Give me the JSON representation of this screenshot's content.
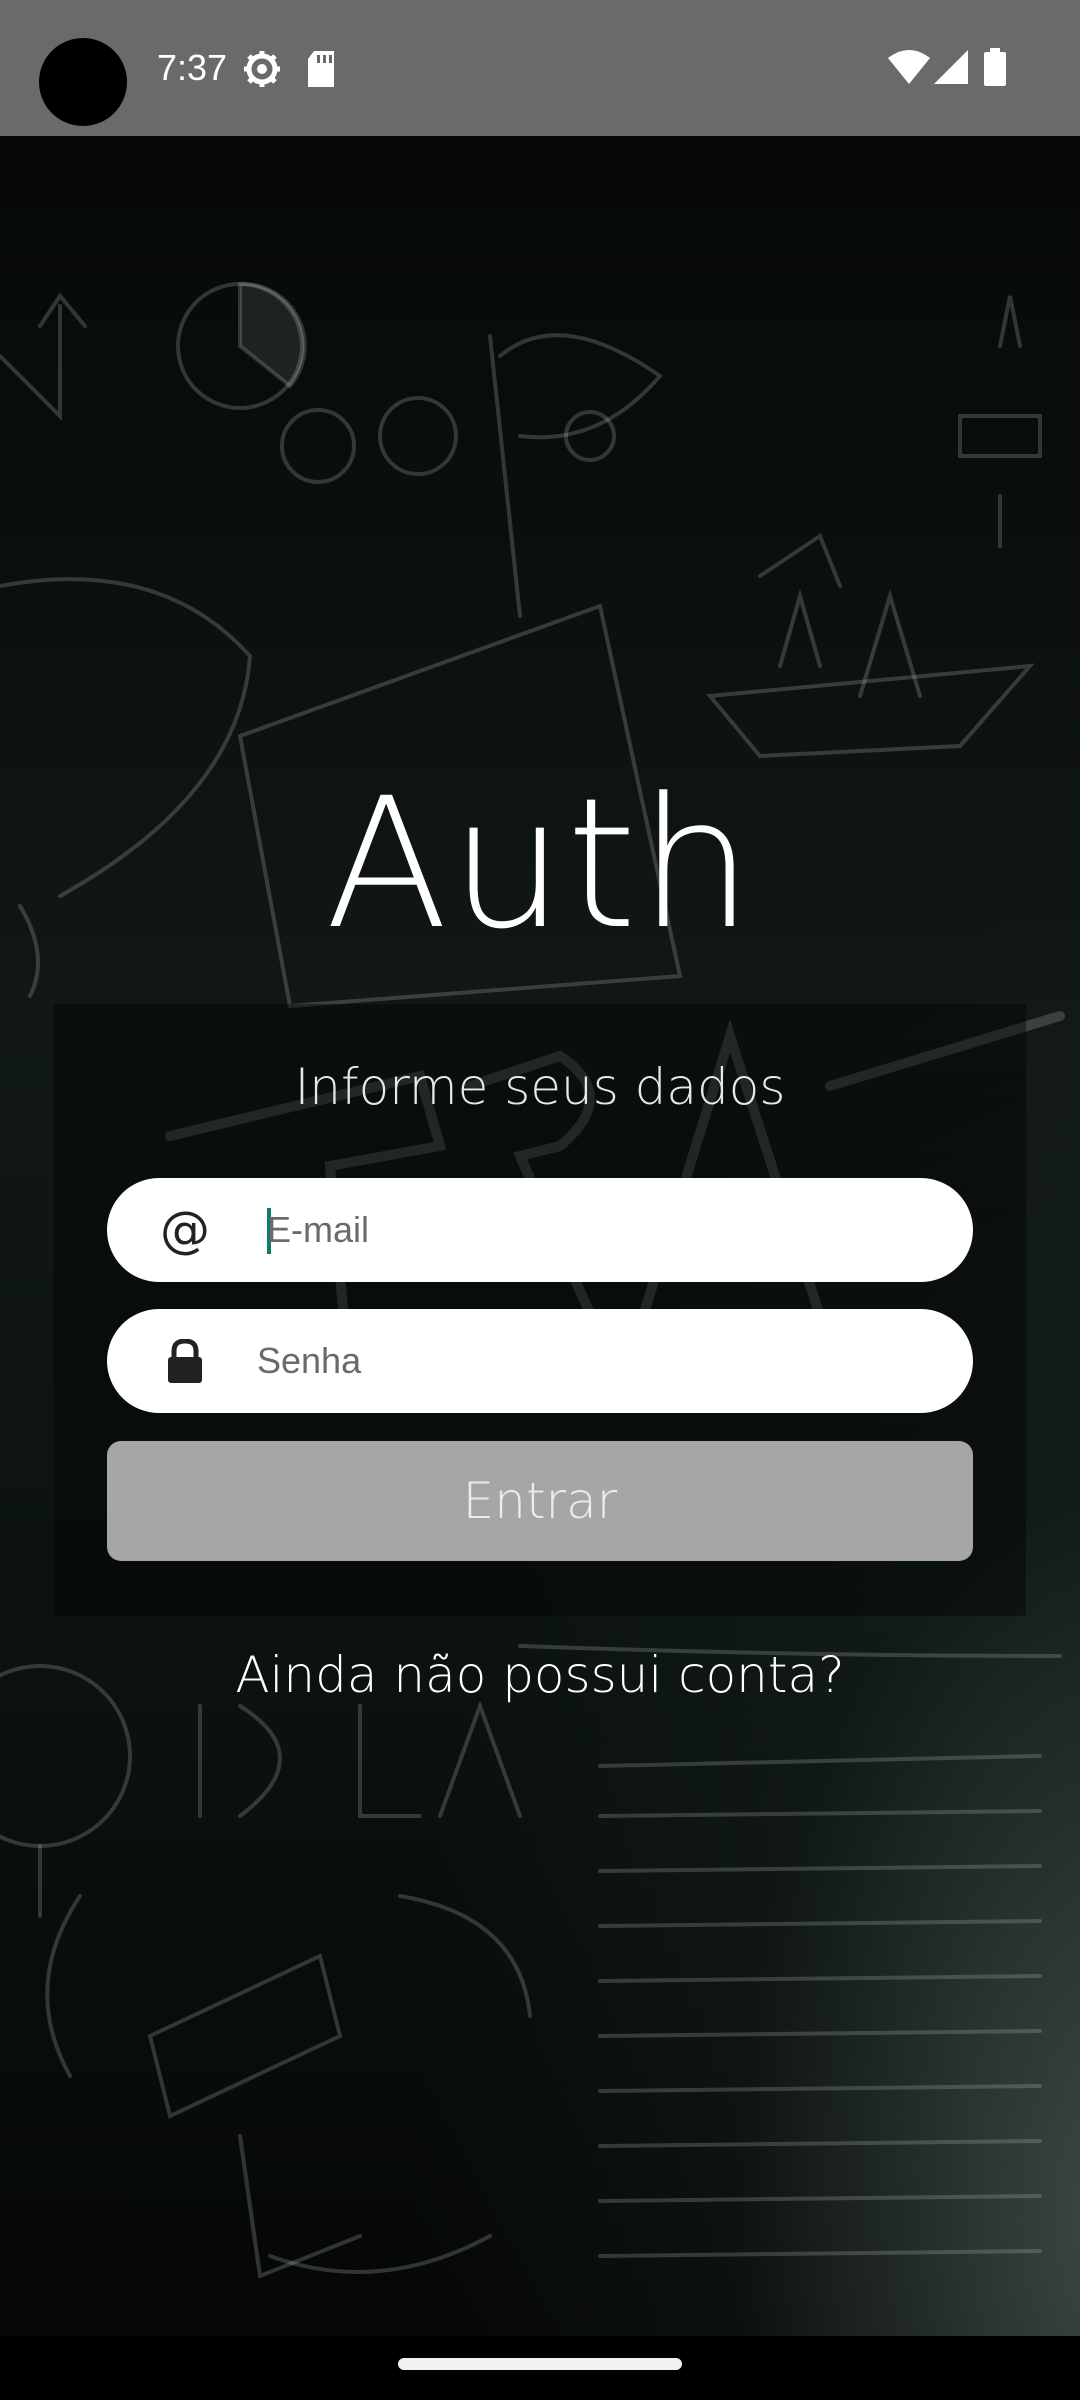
{
  "status_bar": {
    "time": "7:37",
    "icons": [
      "settings-gear-icon",
      "sd-card-icon",
      "wifi-icon",
      "cellular-signal-icon",
      "battery-icon"
    ]
  },
  "app": {
    "title": "Auth"
  },
  "form": {
    "subtitle": "Informe seus dados",
    "email": {
      "icon_glyph": "@",
      "placeholder": "E-mail",
      "value": ""
    },
    "password": {
      "icon": "lock-icon",
      "placeholder": "Senha",
      "value": ""
    },
    "submit_label": "Entrar",
    "register_label": "Ainda não possui conta?"
  },
  "colors": {
    "status_bar_bg": "#6a6a6a",
    "button_disabled_bg": "#a6a6a6",
    "caret": "#117a6a"
  }
}
